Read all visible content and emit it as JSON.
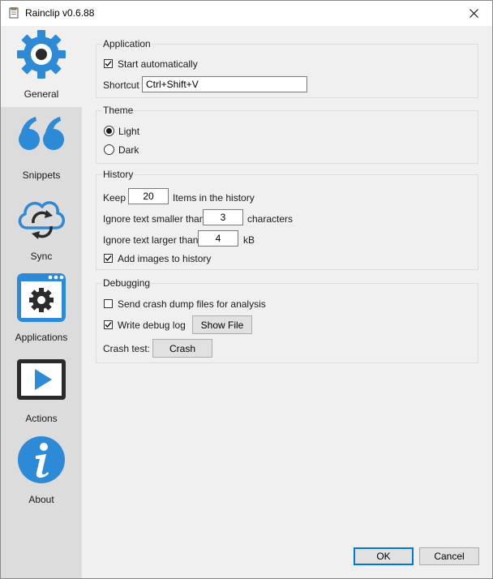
{
  "window": {
    "title": "Rainclip v0.6.88"
  },
  "sidebar": {
    "items": [
      {
        "label": "General"
      },
      {
        "label": "Snippets"
      },
      {
        "label": "Sync"
      },
      {
        "label": "Applications"
      },
      {
        "label": "Actions"
      },
      {
        "label": "About"
      }
    ]
  },
  "application": {
    "title": "Application",
    "start_automatically": "Start automatically",
    "start_automatically_checked": true,
    "shortcut_label": "Shortcut",
    "shortcut_value": "Ctrl+Shift+V"
  },
  "theme": {
    "title": "Theme",
    "light": "Light",
    "dark": "Dark",
    "selected": "Light"
  },
  "history": {
    "title": "History",
    "keep_label": "Keep",
    "keep_value": "20",
    "keep_suffix": "Items in the history",
    "ignore_smaller_label": "Ignore text smaller than",
    "ignore_smaller_value": "3",
    "ignore_smaller_suffix": "characters",
    "ignore_larger_label": "Ignore text larger than",
    "ignore_larger_value": "4",
    "ignore_larger_suffix": "kB",
    "add_images": "Add images to history",
    "add_images_checked": true
  },
  "debugging": {
    "title": "Debugging",
    "send_crash": "Send crash dump files for analysis",
    "send_crash_checked": false,
    "write_debug": "Write debug log",
    "write_debug_checked": true,
    "show_file": "Show File",
    "crash_test_label": "Crash test:",
    "crash_button": "Crash"
  },
  "footer": {
    "ok": "OK",
    "cancel": "Cancel"
  },
  "colors": {
    "accent_blue": "#2d8ad6",
    "default_border": "#0078d7"
  },
  "icons": [
    "gear-icon",
    "quote-icon",
    "cloud-sync-icon",
    "window-gear-icon",
    "play-icon",
    "info-icon",
    "close-icon",
    "app-icon",
    "checkmark-icon"
  ]
}
